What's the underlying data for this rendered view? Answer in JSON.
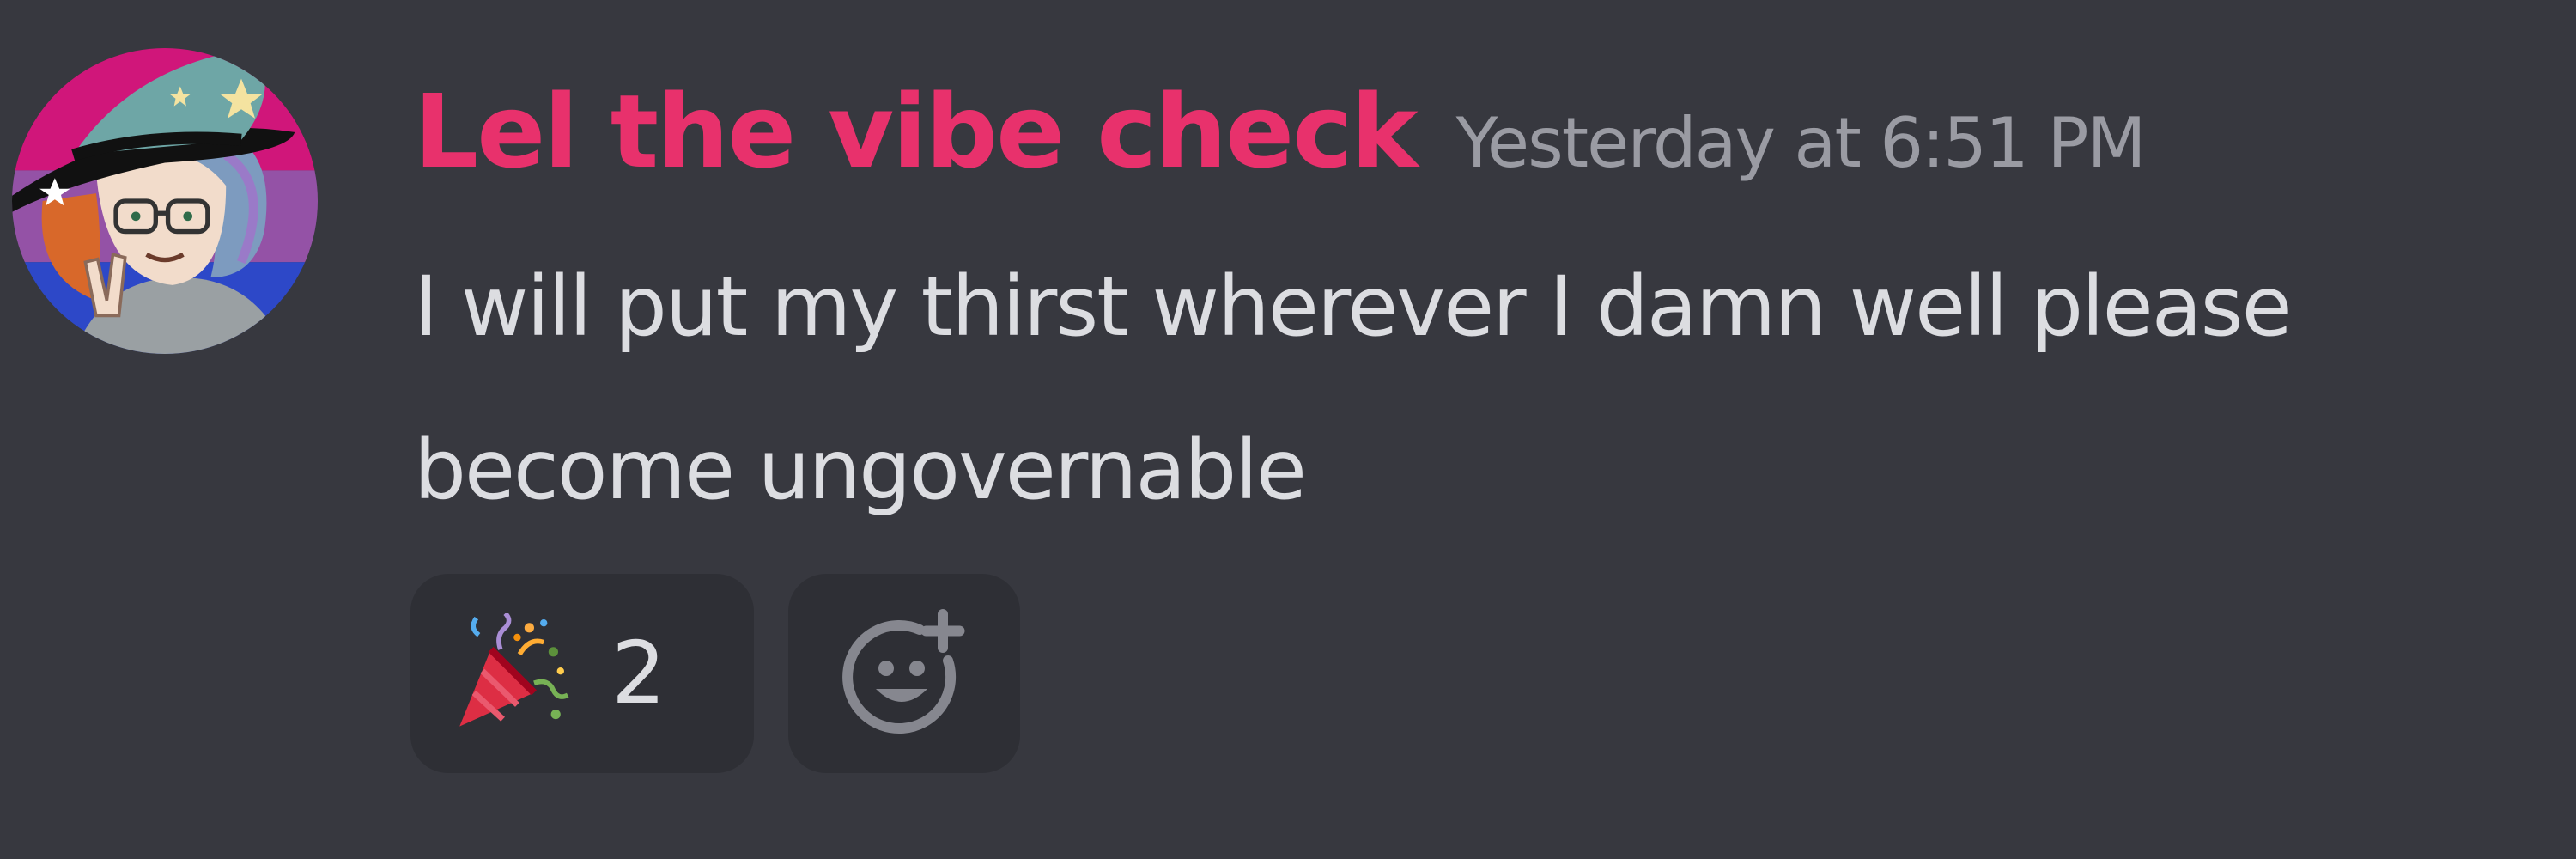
{
  "message": {
    "author": {
      "name": "Lel the vibe check",
      "name_color": "#e8316c",
      "avatar_icon": "avatar-image"
    },
    "timestamp": "Yesterday at 6:51 PM",
    "lines": [
      "I will put my thirst wherever I damn well please",
      "become ungovernable"
    ],
    "reactions": [
      {
        "emoji": "party-popper-icon",
        "count": "2"
      }
    ],
    "add_reaction": {
      "icon": "add-reaction-icon"
    }
  },
  "colors": {
    "background": "#37383f",
    "reaction_background": "#2e2f35",
    "text": "#dcdde1",
    "muted": "#9a9ba3"
  }
}
